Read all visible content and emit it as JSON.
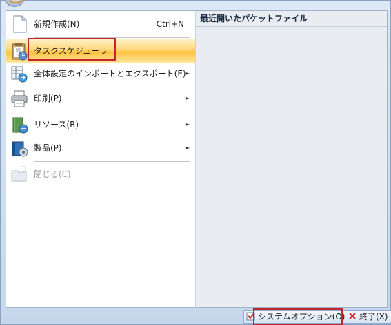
{
  "menu": {
    "items": [
      {
        "label": "新規作成(N)",
        "shortcut": "Ctrl+N",
        "icon": "new-document-icon"
      },
      {
        "label": "タスクスケジューラ",
        "icon": "task-scheduler-icon"
      },
      {
        "label": "全体設定のインポートとエクスポート(E)",
        "icon": "import-export-icon"
      },
      {
        "label": "印刷(P)",
        "icon": "printer-icon"
      },
      {
        "label": "リソース(R)",
        "icon": "resource-book-icon"
      },
      {
        "label": "製品(P)",
        "icon": "product-icon"
      },
      {
        "label": "閉じる(C)",
        "icon": "close-folder-icon"
      }
    ],
    "submenu_arrow": "►"
  },
  "recent": {
    "title": "最近開いたパケットファイル"
  },
  "footer": {
    "options_label": "システムオプション(O)",
    "exit_label": "終了(X)"
  },
  "colors": {
    "highlight": "#ffd77a",
    "annotation_red": "#c0262d"
  }
}
